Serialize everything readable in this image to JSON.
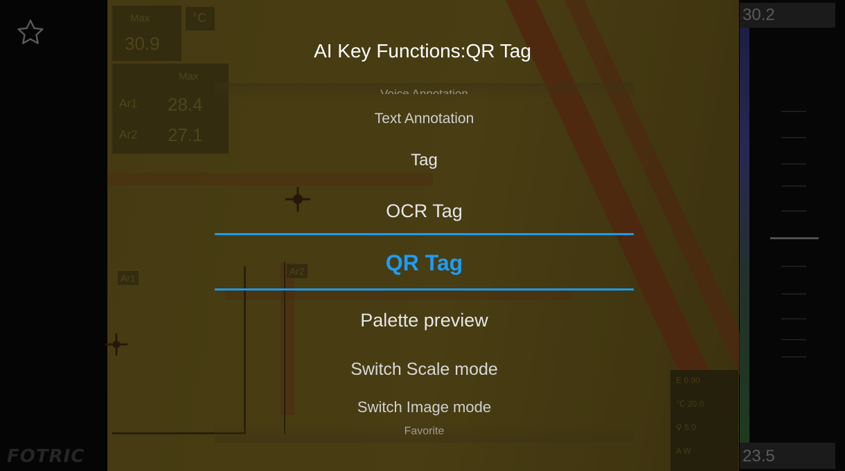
{
  "dialog": {
    "title": "AI Key Functions:QR Tag",
    "options": [
      "Voice Annotation",
      "Text Annotation",
      "Tag",
      "OCR Tag",
      "QR Tag",
      "Palette preview",
      "Switch Scale mode",
      "Switch Image mode",
      "Favorite"
    ],
    "selected": "QR Tag"
  },
  "measure": {
    "max_label": "Max",
    "max_value": "30.9",
    "unit": "°C",
    "table_header": "Max",
    "area1_label": "Ar1",
    "area1_value": "28.4",
    "area2_label": "Ar2",
    "area2_value": "27.1",
    "area1_box_label": "Ar1",
    "area2_box_label": "Ar2"
  },
  "scale": {
    "top": "30.2",
    "bottom": "23.5"
  },
  "params": {
    "emissivity": "0.90",
    "temperature": "20.0",
    "distance": "5.0",
    "mode": "A W"
  },
  "brand": "FOTRIC",
  "icons": {
    "favorite": "star-icon"
  },
  "colors": {
    "accent": "#1e9cf3",
    "selection_line": "#1a9bef"
  }
}
